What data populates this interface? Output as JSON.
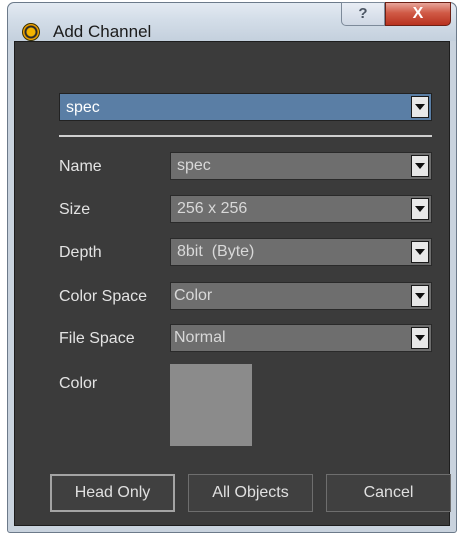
{
  "window": {
    "title": "Add Channel",
    "help_label": "?",
    "close_label": "X"
  },
  "channel_select": {
    "value": "spec"
  },
  "fields": [
    {
      "label": "Name",
      "value": "spec"
    },
    {
      "label": "Size",
      "value": "256 x 256"
    },
    {
      "label": "Depth",
      "value": "8bit  (Byte)"
    },
    {
      "label": "Color Space",
      "value": "Color"
    },
    {
      "label": "File Space",
      "value": "Normal"
    }
  ],
  "color": {
    "label": "Color",
    "swatch": "#8b8b8b"
  },
  "buttons": {
    "head_only": "Head Only",
    "all_objects": "All Objects",
    "cancel": "Cancel"
  }
}
